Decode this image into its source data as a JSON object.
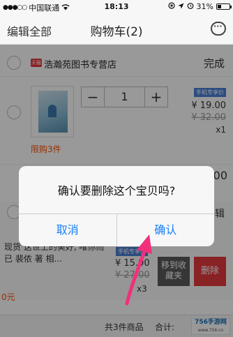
{
  "status": {
    "carrier": "中国联通",
    "time": "18:13",
    "battery": "31%",
    "battery_level": 0.31
  },
  "nav": {
    "edit_all": "编辑全部",
    "title": "购物车(2)"
  },
  "shop": {
    "badge": "天猫",
    "name": "浩瀚苑图书专营店",
    "done": "完成"
  },
  "item1": {
    "quantity": "1",
    "minus": "−",
    "plus": "+",
    "limit": "限购3件",
    "badge": "手机专享价",
    "price": "¥ 19.00",
    "old_price": "¥ 32.00",
    "count": "x1"
  },
  "item2": {
    "edit": "辑",
    "desc": "现货 这世上的美好, 唯你而已 裴侬 著 相...",
    "badge": "手机专享价",
    "price": "¥ 15.90",
    "old_price": "¥ 27.00",
    "count": "x3",
    "fav": "移到收藏夹",
    "del": "删除",
    "zero": "0元"
  },
  "footer": {
    "total": "共3件商品",
    "sum": "合计:"
  },
  "logo": {
    "text": "756手游网",
    "sub": "www.756.cn"
  },
  "dialog": {
    "message": "确认要删除这个宝贝吗?",
    "cancel": "取消",
    "confirm": "确认"
  },
  "colors": {
    "accent_blue": "#157efb",
    "price_orange": "#ff5000",
    "delete_red": "#e4393c",
    "arrow_pink": "#f0307a"
  },
  "icons": {
    "wifi": "wifi-icon",
    "message": "message-icon",
    "arrow": "pointer-arrow"
  }
}
